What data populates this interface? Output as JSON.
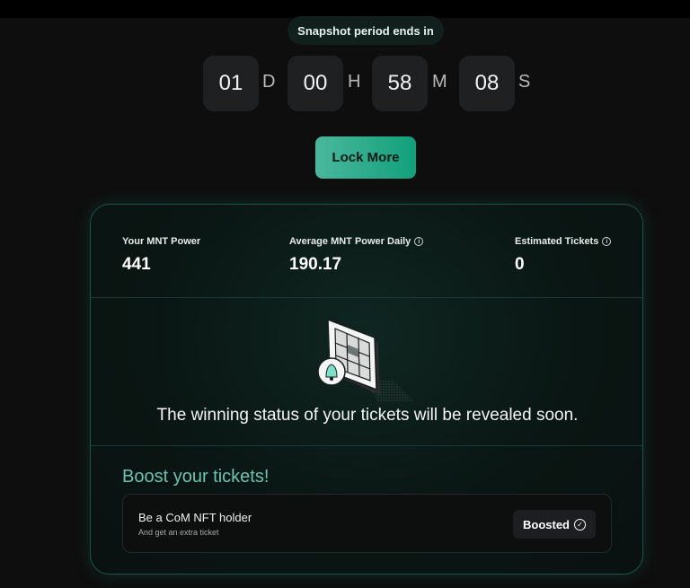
{
  "snapshot": {
    "label": "Snapshot period ends in"
  },
  "countdown": {
    "days": "01",
    "days_unit": "D",
    "hours": "00",
    "hours_unit": "H",
    "minutes": "58",
    "minutes_unit": "M",
    "seconds": "08",
    "seconds_unit": "S"
  },
  "actions": {
    "lock_more_label": "Lock More"
  },
  "stats": {
    "mnt_power_label": "Your MNT Power",
    "mnt_power_value": "441",
    "avg_power_label": "Average MNT Power Daily",
    "avg_power_value": "190.17",
    "est_tickets_label": "Estimated Tickets",
    "est_tickets_value": "0"
  },
  "reveal": {
    "message": "The winning status of your tickets will be revealed soon."
  },
  "boost": {
    "title": "Boost your tickets!",
    "nft_title": "Be a CoM NFT holder",
    "nft_subtitle": "And get an extra ticket",
    "badge_label": "Boosted"
  },
  "colors": {
    "accent": "#12a07b",
    "accent_light": "#6cc4ad",
    "card_border": "#1f5244",
    "background": "#0e0e0e"
  },
  "icons": [
    "info-icon",
    "check-circle-icon",
    "ticket-bell-illustration"
  ]
}
